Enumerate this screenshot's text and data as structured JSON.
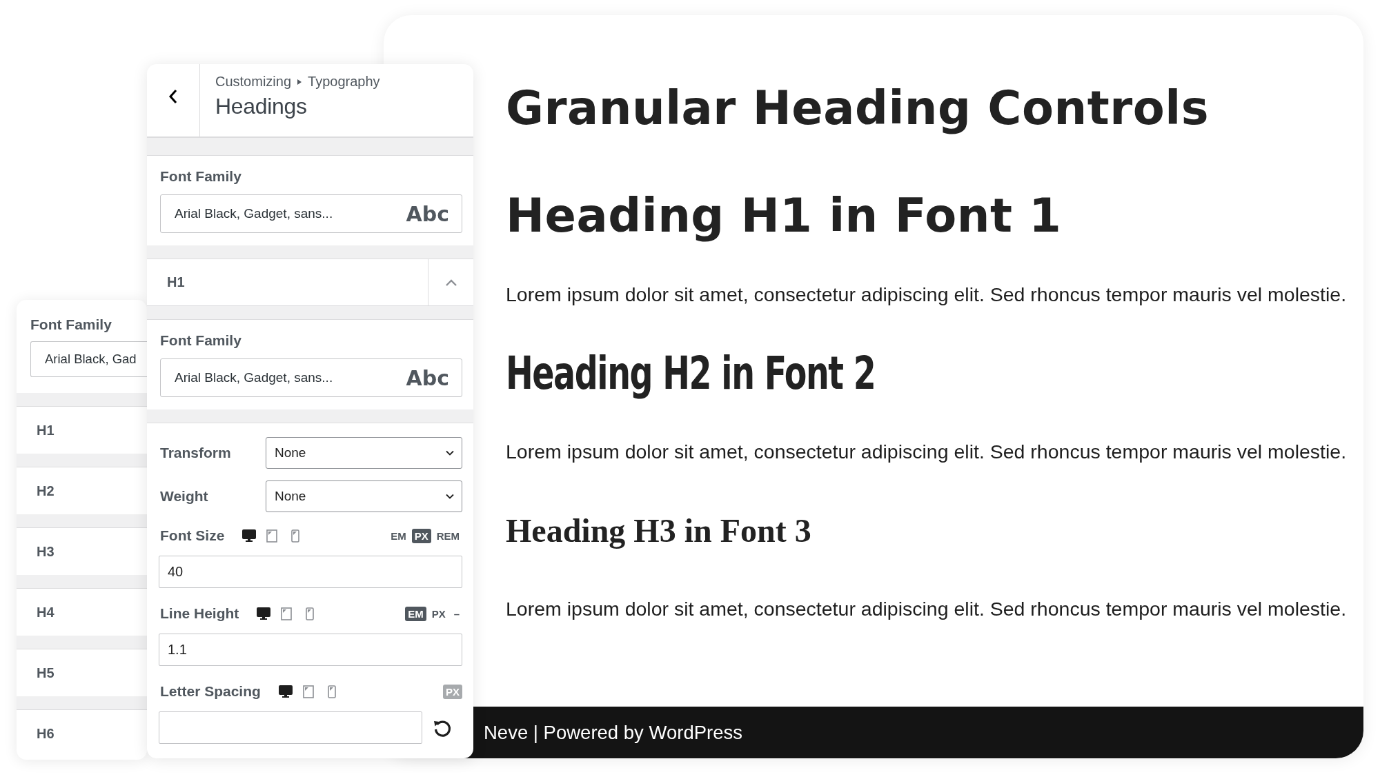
{
  "back_panel": {
    "font_family": {
      "label": "Font Family",
      "value": "Arial Black, Gad"
    },
    "headings": [
      "H1",
      "H2",
      "H3",
      "H4",
      "H5",
      "H6"
    ]
  },
  "customizer": {
    "breadcrumb_parent": "Customizing",
    "breadcrumb_current": "Typography",
    "title": "Headings",
    "global_font": {
      "label": "Font Family",
      "value": "Arial Black, Gadget, sans...",
      "preview": "Abc"
    },
    "heading_group": {
      "label": "H1",
      "expanded": true
    },
    "heading_font": {
      "label": "Font Family",
      "value": "Arial Black, Gadget, sans...",
      "preview": "Abc"
    },
    "selects": [
      {
        "label": "Transform",
        "value": "None"
      },
      {
        "label": "Weight",
        "value": "None"
      }
    ],
    "sizes": [
      {
        "label": "Font Size",
        "devices": [
          {
            "selected": true
          },
          {
            "selected": false
          },
          {
            "selected": false
          }
        ],
        "units": [
          {
            "label": "EM",
            "selected": false,
            "disabled": false
          },
          {
            "label": "PX",
            "selected": true,
            "disabled": false
          },
          {
            "label": "REM",
            "selected": false,
            "disabled": false
          }
        ],
        "value": "40"
      },
      {
        "label": "Line Height",
        "devices": [
          {
            "selected": true
          },
          {
            "selected": false
          },
          {
            "selected": false
          }
        ],
        "units": [
          {
            "label": "EM",
            "selected": true,
            "disabled": false
          },
          {
            "label": "PX",
            "selected": false,
            "disabled": false
          },
          {
            "label": "–",
            "selected": false,
            "disabled": false
          }
        ],
        "value": "1.1"
      },
      {
        "label": "Letter Spacing",
        "devices": [
          {
            "selected": true
          },
          {
            "selected": false
          },
          {
            "selected": false
          }
        ],
        "units": [
          {
            "label": "PX",
            "selected": false,
            "disabled": true
          }
        ],
        "reset": true
      }
    ]
  },
  "preview": {
    "blocks": [
      {
        "kind": "title",
        "text": "Granular Heading Controls"
      },
      {
        "kind": "h1",
        "text": "Heading H1 in Font 1"
      },
      {
        "kind": "paragraph",
        "text": "Lorem ipsum dolor sit amet, consectetur adipiscing elit. Sed rhoncus tempor mauris vel molestie."
      },
      {
        "kind": "h2",
        "text": "Heading H2 in Font 2"
      },
      {
        "kind": "paragraph",
        "text": "Lorem ipsum dolor sit amet, consectetur adipiscing elit. Sed rhoncus tempor mauris vel molestie."
      },
      {
        "kind": "h3",
        "text": "Heading H3 in Font 3"
      },
      {
        "kind": "paragraph",
        "text": "Lorem ipsum dolor sit amet, consectetur adipiscing elit. Sed rhoncus tempor mauris vel molestie."
      }
    ],
    "footer": "Neve | Powered by WordPress"
  }
}
